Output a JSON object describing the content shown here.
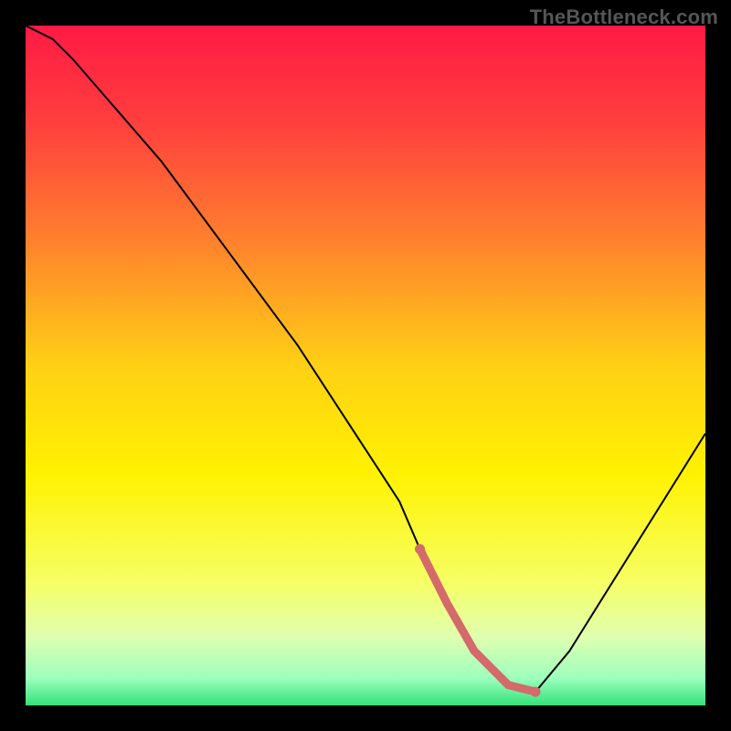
{
  "watermark": {
    "text": "TheBottleneck.com"
  },
  "chart_data": {
    "type": "line",
    "title": "",
    "xlabel": "",
    "ylabel": "",
    "xlim": [
      0,
      100
    ],
    "ylim": [
      0,
      100
    ],
    "grid": false,
    "legend": null,
    "background_gradient": {
      "direction": "vertical",
      "stops": [
        {
          "pos": 0.0,
          "color": "#ff1a44"
        },
        {
          "pos": 0.14,
          "color": "#ff3e3e"
        },
        {
          "pos": 0.3,
          "color": "#ff7a2f"
        },
        {
          "pos": 0.5,
          "color": "#ffd015"
        },
        {
          "pos": 0.66,
          "color": "#fff200"
        },
        {
          "pos": 0.82,
          "color": "#f6ff66"
        },
        {
          "pos": 0.9,
          "color": "#dfffb0"
        },
        {
          "pos": 0.96,
          "color": "#9cffbd"
        },
        {
          "pos": 1.0,
          "color": "#33e27a"
        }
      ]
    },
    "series": [
      {
        "name": "bottleneck-curve",
        "color": "#000000",
        "stroke_width": 2,
        "x": [
          0,
          4,
          7,
          20,
          40,
          55,
          58,
          62,
          66,
          71,
          75,
          80,
          100
        ],
        "values": [
          100,
          98,
          95,
          80,
          53,
          30,
          23,
          15,
          8,
          3,
          2,
          8,
          40
        ]
      },
      {
        "name": "optimal-zone-highlight",
        "color": "#d46a6a",
        "stroke_width": 9,
        "linecap": "round",
        "x": [
          58,
          62,
          66,
          71,
          75
        ],
        "values": [
          23,
          15,
          8,
          3,
          2
        ],
        "segment_of": "bottleneck-curve",
        "note": "Highlighted sweet-spot region near the curve minimum"
      }
    ]
  }
}
